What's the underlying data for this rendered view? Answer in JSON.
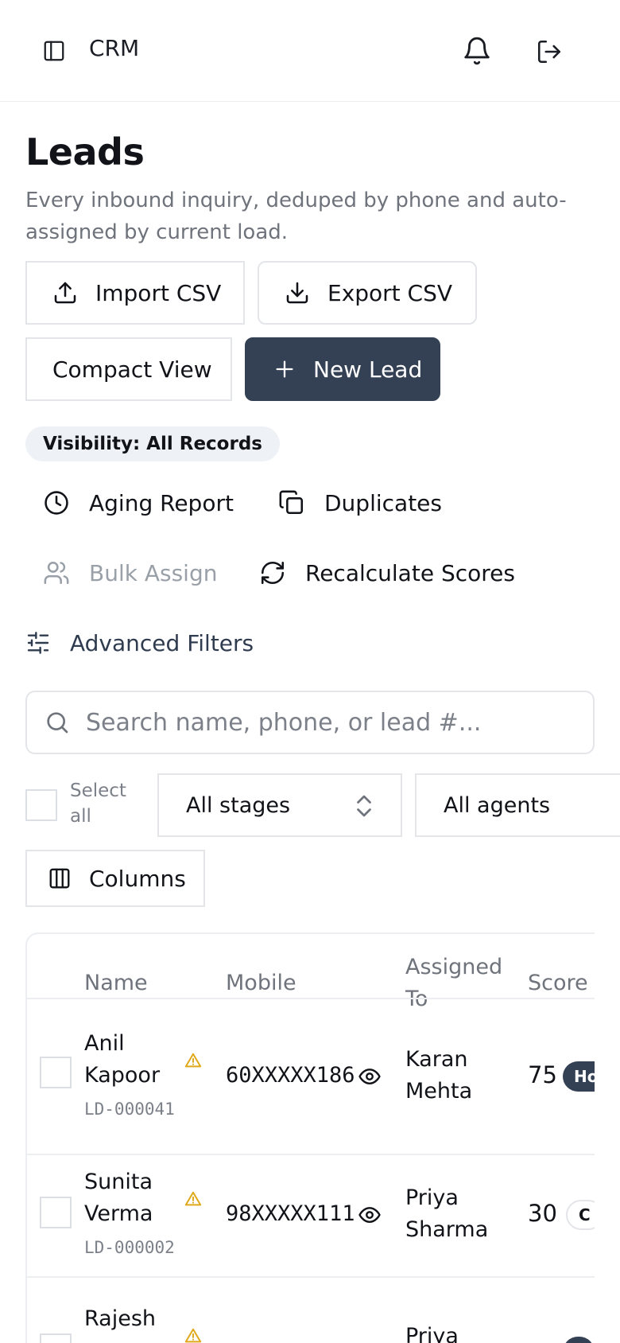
{
  "header": {
    "brand": "CRM",
    "icons": [
      "sidebar-toggle-icon",
      "bell-icon",
      "logout-icon"
    ]
  },
  "page": {
    "title": "Leads",
    "subtitle": "Every inbound inquiry, deduped by phone and auto-assigned by current load."
  },
  "actions": {
    "import_csv": "Import CSV",
    "export_csv": "Export CSV",
    "compact_view": "Compact View",
    "new_lead": "New Lead"
  },
  "visibility_badge": "Visibility: All Records",
  "tools": {
    "aging_report": "Aging Report",
    "duplicates": "Duplicates",
    "bulk_assign": "Bulk Assign",
    "recalculate_scores": "Recalculate Scores",
    "advanced_filters": "Advanced Filters"
  },
  "search": {
    "placeholder": "Search name, phone, or lead #..."
  },
  "filters": {
    "select_all_line1": "Select",
    "select_all_line2": "all",
    "stage": "All stages",
    "agent": "All agents",
    "columns": "Columns"
  },
  "table": {
    "headers": {
      "name": "Name",
      "mobile": "Mobile",
      "assigned_line1": "Assigned",
      "assigned_line2": "To",
      "score": "Score"
    },
    "rows": [
      {
        "name_line1": "Anil",
        "name_line2": "Kapoor",
        "lead_id": "LD-000041",
        "mobile": "60XXXXX186",
        "assigned_line1": "Karan",
        "assigned_line2": "Mehta",
        "score": "75",
        "badge": "Ho"
      },
      {
        "name_line1": "Sunita",
        "name_line2": "Verma",
        "lead_id": "LD-000002",
        "mobile": "98XXXXX111",
        "assigned_line1": "Priya",
        "assigned_line2": "Sharma",
        "score": "30",
        "badge": "C"
      },
      {
        "name_line1": "Rajesh",
        "assigned_line1": "Priya"
      }
    ]
  },
  "colors": {
    "primary": "#344154",
    "warning": "#e0a91c",
    "muted": "#6f737b",
    "border": "#e3e5e9"
  }
}
